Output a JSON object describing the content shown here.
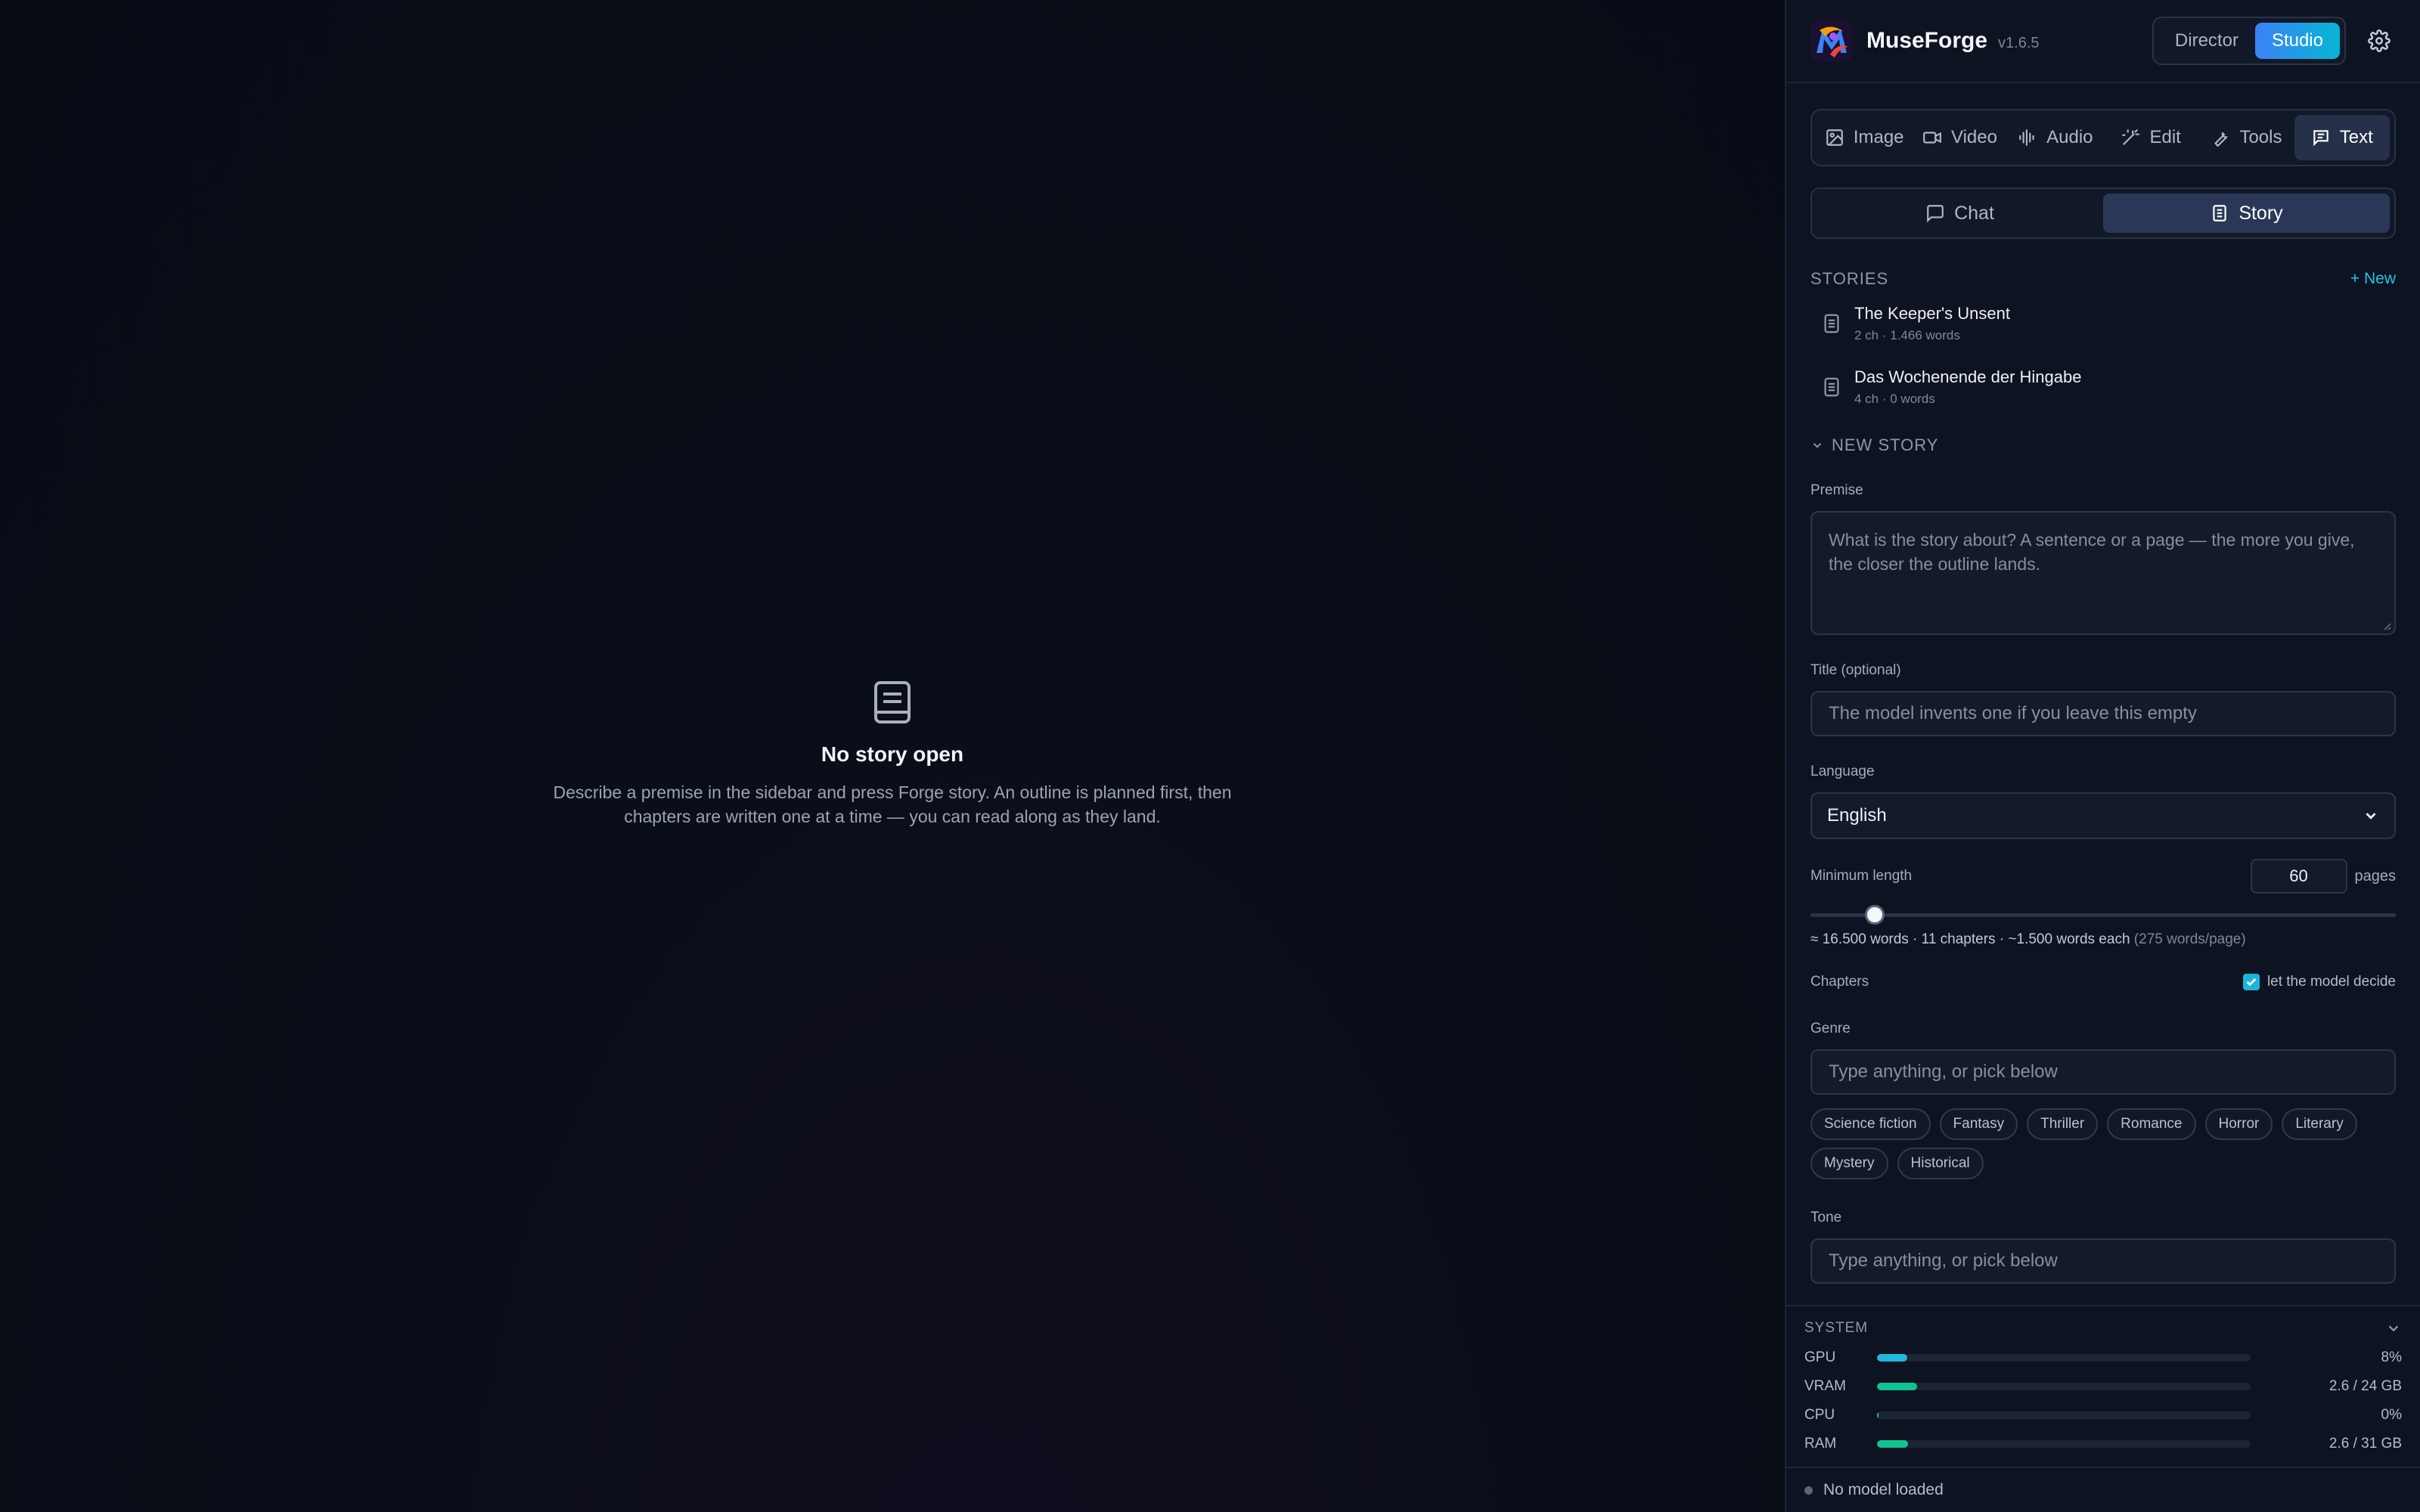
{
  "app": {
    "name": "MuseForge",
    "version": "v1.6.5",
    "modes": [
      "Director",
      "Studio"
    ],
    "active_mode": "Studio"
  },
  "categories": [
    {
      "label": "Image",
      "icon": "image-icon"
    },
    {
      "label": "Video",
      "icon": "video-icon"
    },
    {
      "label": "Audio",
      "icon": "audio-wave-icon"
    },
    {
      "label": "Edit",
      "icon": "magic-wand-icon"
    },
    {
      "label": "Tools",
      "icon": "wrench-icon"
    },
    {
      "label": "Text",
      "icon": "text-doc-icon",
      "active": true
    }
  ],
  "subtabs": [
    {
      "label": "Chat",
      "icon": "chat-bubble-icon"
    },
    {
      "label": "Story",
      "icon": "document-icon",
      "active": true
    }
  ],
  "stories": {
    "section_title": "STORIES",
    "new_label": "+ New",
    "items": [
      {
        "title": "The Keeper's Unsent",
        "meta": "2 ch · 1.466 words"
      },
      {
        "title": "Das Wochenende der Hingabe",
        "meta": "4 ch · 0 words"
      }
    ]
  },
  "new_story": {
    "section_title": "NEW STORY",
    "premise_label": "Premise",
    "premise_placeholder": "What is the story about? A sentence or a page — the more you give, the closer the outline lands.",
    "title_label": "Title (optional)",
    "title_placeholder": "The model invents one if you leave this empty",
    "language_label": "Language",
    "language_value": "English",
    "min_length_label": "Minimum length",
    "min_length_value": "60",
    "min_length_unit": "pages",
    "min_length_slider_fraction": 0.11,
    "estimate_text": "≈ 16.500 words · 11 chapters · ~1.500 words each",
    "estimate_note": "(275 words/page)",
    "chapters_label": "Chapters",
    "chapters_auto_label": "let the model decide",
    "chapters_auto_checked": true,
    "genre_label": "Genre",
    "genre_placeholder": "Type anything, or pick below",
    "genres": [
      "Science fiction",
      "Fantasy",
      "Thriller",
      "Romance",
      "Horror",
      "Literary",
      "Mystery",
      "Historical"
    ],
    "tone_label": "Tone",
    "tone_placeholder": "Type anything, or pick below"
  },
  "system": {
    "title": "SYSTEM",
    "metrics": [
      {
        "label": "GPU",
        "value": "8%",
        "fraction": 0.08,
        "color": "#22b8dd"
      },
      {
        "label": "VRAM",
        "value": "2.6 / 24 GB",
        "fraction": 0.108,
        "color": "#10c48f"
      },
      {
        "label": "CPU",
        "value": "0%",
        "fraction": 0.004,
        "color": "#22b8dd"
      },
      {
        "label": "RAM",
        "value": "2.6 / 31 GB",
        "fraction": 0.084,
        "color": "#10c48f"
      }
    ]
  },
  "status": {
    "text": "No model loaded"
  },
  "empty_state": {
    "icon": "book-icon",
    "title": "No story open",
    "description": "Describe a premise in the sidebar and press Forge story. An outline is planned first, then chapters are written one at a time — you can read along as they land."
  }
}
